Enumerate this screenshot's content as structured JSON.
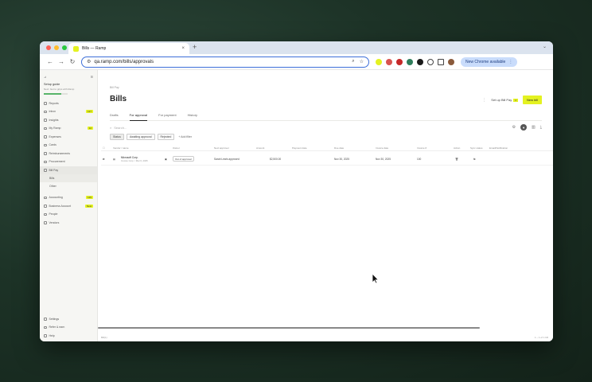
{
  "colors": {
    "accent": "#e4f221",
    "omnibox_focus": "#3d6fd9",
    "progress": "#58b56a"
  },
  "browser": {
    "tab_title": "Bills — Ramp",
    "tab_close": "×",
    "new_tab": "+",
    "tab_menu": "⌄",
    "back": "←",
    "forward": "→",
    "reload": "↻",
    "url": "qa.ramp.com/bills/approvals",
    "new_chrome_label": "New Chrome available",
    "new_chrome_menu": "⋮"
  },
  "sidebar": {
    "logo": "⊿",
    "collapse": "⊞",
    "setup_title": "Setup guide",
    "setup_subtitle": "Next: Get to grips with Ramp",
    "setup_progress": 0.72,
    "items": [
      {
        "label": "Reports",
        "badge": ""
      },
      {
        "label": "Inbox",
        "badge": "127"
      },
      {
        "label": "Insights",
        "badge": ""
      },
      {
        "label": "My Ramp",
        "badge": "12"
      },
      {
        "label": "Expenses",
        "badge": ""
      },
      {
        "label": "Cards",
        "badge": ""
      },
      {
        "label": "Reimbursements",
        "badge": ""
      },
      {
        "label": "Procurement",
        "badge": ""
      },
      {
        "label": "Bill Pay",
        "badge": ""
      }
    ],
    "subitems": [
      "Bills",
      "Other"
    ],
    "items_lower": [
      {
        "label": "Accounting",
        "badge": "129"
      },
      {
        "label": "Business Account",
        "badge": "New"
      },
      {
        "label": "People",
        "badge": ""
      },
      {
        "label": "Vendors",
        "badge": ""
      }
    ],
    "bottom": [
      "Settings",
      "Refer & earn",
      "Help"
    ]
  },
  "main": {
    "breadcrumb": "Bill Pay",
    "title": "Bills",
    "more": "⋮",
    "setup_billpay": "Set up Bill Pay",
    "setup_badge": "2",
    "new_bill": "New bill",
    "tabs": [
      "Drafts",
      "For approval",
      "For payment",
      "History"
    ],
    "active_tab": 1,
    "search_placeholder": "Search...",
    "filters": [
      "Status",
      "Awaiting approval",
      "Rejected"
    ],
    "add_filter": "+ Add filter",
    "columns": [
      "Vendor / name",
      "Owner",
      "Status",
      "Next approver",
      "Amount",
      "Payment date",
      "Due date",
      "Invoice date",
      "Invoice #",
      "Action",
      "Sync status",
      "Email/Notification"
    ],
    "rows": [
      {
        "vendor": "Microsoft Corp.",
        "vendor_sub": "Invoice Corp. / Mar 6, 2025",
        "status": "Out of approval",
        "approver": "Sarah Lewis approved",
        "amount": "$2,500.00",
        "due": "Nov 30, 2025",
        "invoice_date": "Nov 30, 2025",
        "invoice_no": "100"
      }
    ],
    "footer_left": "Bill(1)",
    "footer_right": "1 – 1 of 1 bill"
  }
}
